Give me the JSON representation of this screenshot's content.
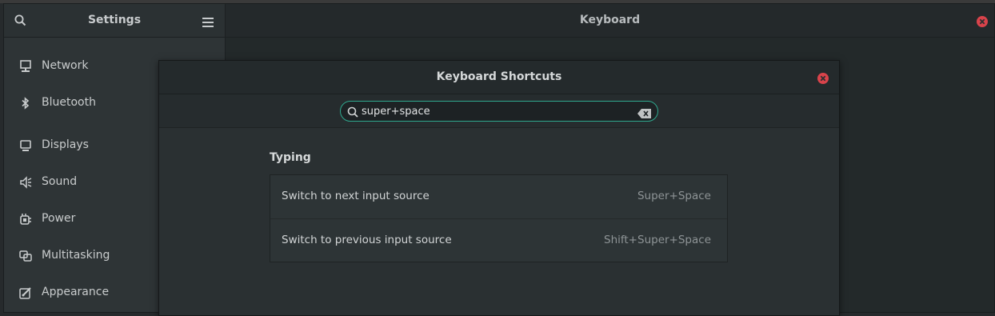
{
  "settings": {
    "title": "Settings",
    "sidebar": [
      {
        "label": "Network",
        "icon": "network-icon"
      },
      {
        "label": "Bluetooth",
        "icon": "bluetooth-icon"
      },
      {
        "label": "Displays",
        "icon": "display-icon"
      },
      {
        "label": "Sound",
        "icon": "speaker-icon"
      },
      {
        "label": "Power",
        "icon": "power-plug-icon"
      },
      {
        "label": "Multitasking",
        "icon": "multitasking-icon"
      },
      {
        "label": "Appearance",
        "icon": "appearance-icon"
      }
    ]
  },
  "main": {
    "title": "Keyboard"
  },
  "dialog": {
    "title": "Keyboard Shortcuts",
    "search": {
      "value": "super+space"
    },
    "section": "Typing",
    "shortcuts": [
      {
        "name": "Switch to next input source",
        "accel": "Super+Space"
      },
      {
        "name": "Switch to previous input source",
        "accel": "Shift+Super+Space"
      }
    ]
  },
  "colors": {
    "accent": "#2fa88e",
    "close": "#d9434b",
    "background": "#222829"
  }
}
